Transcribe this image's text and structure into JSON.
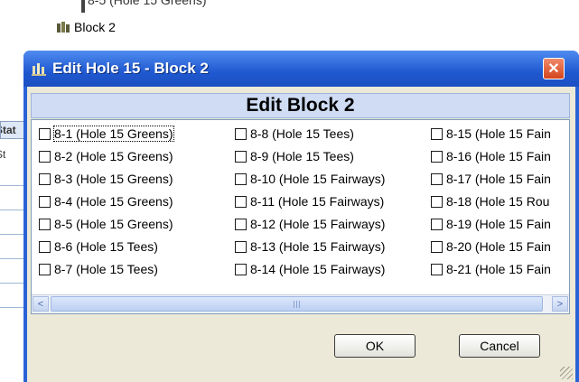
{
  "background": {
    "tree_partial_text": "8-5  (Hole 15 Greens)",
    "tree_node_label": "Block 2",
    "grid_header": "Stat",
    "grid_subheader": "St"
  },
  "dialog": {
    "title": "Edit Hole 15 - Block 2",
    "close_glyph": "✕",
    "block_title": "Edit Block 2",
    "items": [
      {
        "label": "8-1  (Hole 15 Greens)",
        "checked": false
      },
      {
        "label": "8-2  (Hole 15 Greens)",
        "checked": false
      },
      {
        "label": "8-3  (Hole 15 Greens)",
        "checked": false
      },
      {
        "label": "8-4  (Hole 15 Greens)",
        "checked": false
      },
      {
        "label": "8-5  (Hole 15 Greens)",
        "checked": false
      },
      {
        "label": "8-6  (Hole 15 Tees)",
        "checked": false
      },
      {
        "label": "8-7  (Hole 15 Tees)",
        "checked": false
      },
      {
        "label": "8-8  (Hole 15 Tees)",
        "checked": false
      },
      {
        "label": "8-9  (Hole 15 Tees)",
        "checked": false
      },
      {
        "label": "8-10  (Hole 15 Fairways)",
        "checked": false
      },
      {
        "label": "8-11  (Hole 15 Fairways)",
        "checked": false
      },
      {
        "label": "8-12  (Hole 15 Fairways)",
        "checked": false
      },
      {
        "label": "8-13  (Hole 15 Fairways)",
        "checked": false
      },
      {
        "label": "8-14  (Hole 15 Fairways)",
        "checked": false
      },
      {
        "label": "8-15  (Hole 15 Fain",
        "checked": false
      },
      {
        "label": "8-16  (Hole 15 Fain",
        "checked": false
      },
      {
        "label": "8-17  (Hole 15 Fain",
        "checked": false
      },
      {
        "label": "8-18  (Hole 15 Rou",
        "checked": false
      },
      {
        "label": "8-19  (Hole 15 Fain",
        "checked": false
      },
      {
        "label": "8-20  (Hole 15 Fain",
        "checked": false
      },
      {
        "label": "8-21  (Hole 15 Fain",
        "checked": false
      }
    ],
    "scroll_left_glyph": "<",
    "scroll_right_glyph": ">",
    "ok_label": "OK",
    "cancel_label": "Cancel"
  },
  "colors": {
    "titlebar": "#1f58d0",
    "close_button": "#d4441c",
    "dialog_face": "#ece9d8",
    "block_title_bg": "#cfdcf3"
  },
  "icons": {
    "tree_node": "folder-group-icon",
    "title": "app-icon",
    "close": "close-icon",
    "scroll_left": "chevron-left-icon",
    "scroll_right": "chevron-right-icon"
  }
}
